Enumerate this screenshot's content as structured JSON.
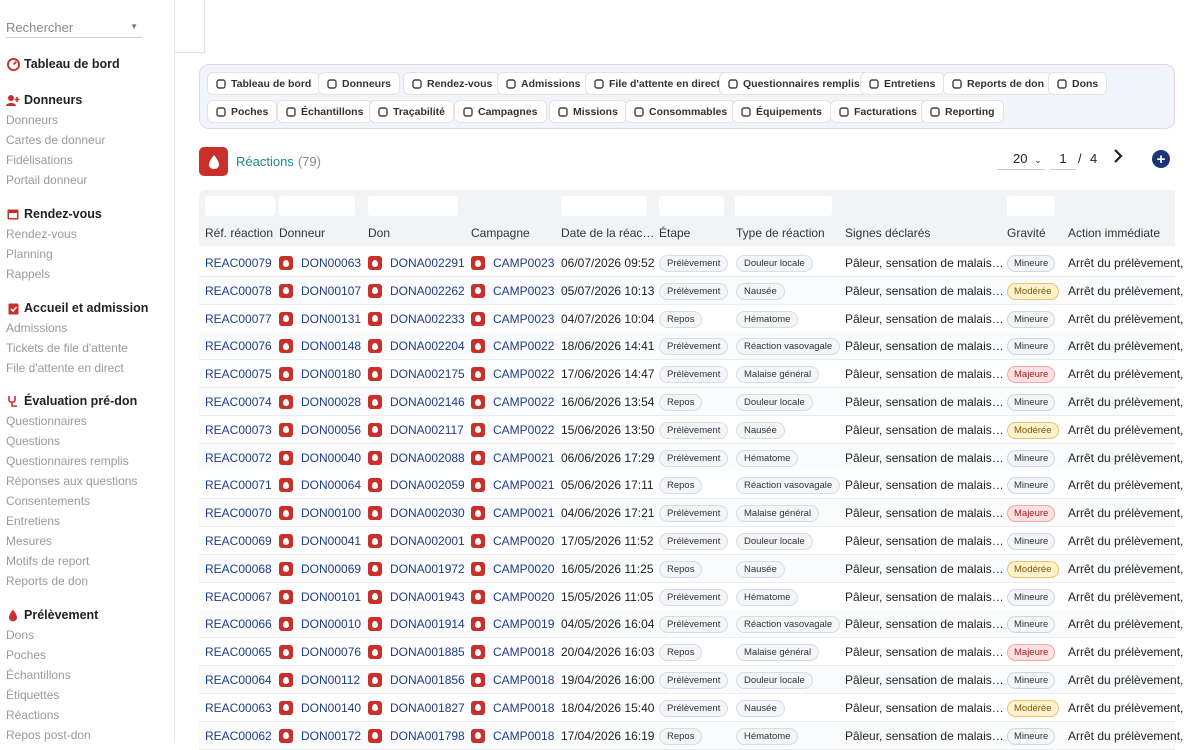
{
  "search": {
    "placeholder": "Rechercher"
  },
  "sidebar": {
    "dashboard": "Tableau de bord",
    "sections": [
      {
        "title": "Donneurs",
        "icon": "user-plus-icon",
        "items": [
          "Donneurs",
          "Cartes de donneur",
          "Fidélisations",
          "Portail donneur"
        ]
      },
      {
        "title": "Rendez-vous",
        "icon": "calendar-icon",
        "items": [
          "Rendez-vous",
          "Planning",
          "Rappels"
        ]
      },
      {
        "title": "Accueil et admission",
        "icon": "clipboard-icon",
        "items": [
          "Admissions",
          "Tickets de file d'attente",
          "File d'attente en direct"
        ]
      },
      {
        "title": "Évaluation pré-don",
        "icon": "stethoscope-icon",
        "items": [
          "Questionnaires",
          "Questions",
          "Questionnaires remplis",
          "Réponses aux questions",
          "Consentements",
          "Entretiens",
          "Mesures",
          "Motifs de report",
          "Reports de don"
        ]
      },
      {
        "title": "Prélèvement",
        "icon": "blood-drop-icon",
        "items": [
          "Dons",
          "Poches",
          "Échantillons",
          "Étiquettes",
          "Réactions",
          "Repos post-don"
        ]
      }
    ]
  },
  "modules": [
    "Tableau de bord",
    "Donneurs",
    "Rendez-vous",
    "Admissions",
    "File d'attente en direct",
    "Questionnaires remplis",
    "Entretiens",
    "Reports de don",
    "Dons",
    "Poches",
    "Échantillons",
    "Traçabilité",
    "Campagnes",
    "Missions",
    "Consommables",
    "Équipements",
    "Facturations",
    "Reporting"
  ],
  "page": {
    "title": "Réactions",
    "count": "(79)"
  },
  "pager": {
    "page_size": "20",
    "page": "1",
    "separator": "/",
    "total_pages": "4"
  },
  "colors": {
    "accent": "#c9302c",
    "link": "#1f3c88",
    "title": "#1a8a8a",
    "add_button": "#1a3578"
  },
  "table": {
    "headers": [
      "Réf. réaction",
      "Donneur",
      "Don",
      "Campagne",
      "Date de la réac…",
      "Étape",
      "Type de réaction",
      "Signes déclarés",
      "Gravité",
      "Action immédiate"
    ],
    "rows": [
      [
        "REAC00079",
        "DON00063",
        "DONA002291",
        "CAMP0023",
        "06/07/2026 09:52",
        "Prélèvement",
        "Douleur locale",
        "Pâleur, sensation de malais…",
        "Mineure",
        "Arrêt du prélèvement,"
      ],
      [
        "REAC00078",
        "DON00107",
        "DONA002262",
        "CAMP0023",
        "05/07/2026 10:13",
        "Prélèvement",
        "Nausée",
        "Pâleur, sensation de malais…",
        "Modérée",
        "Arrêt du prélèvement,"
      ],
      [
        "REAC00077",
        "DON00131",
        "DONA002233",
        "CAMP0023",
        "04/07/2026 10:04",
        "Repos",
        "Hématome",
        "Pâleur, sensation de malais…",
        "Mineure",
        "Arrêt du prélèvement,"
      ],
      [
        "REAC00076",
        "DON00148",
        "DONA002204",
        "CAMP0022",
        "18/06/2026 14:41",
        "Prélèvement",
        "Réaction vasovagale",
        "Pâleur, sensation de malais…",
        "Mineure",
        "Arrêt du prélèvement,"
      ],
      [
        "REAC00075",
        "DON00180",
        "DONA002175",
        "CAMP0022",
        "17/06/2026 14:47",
        "Prélèvement",
        "Malaise général",
        "Pâleur, sensation de malais…",
        "Majeure",
        "Arrêt du prélèvement,"
      ],
      [
        "REAC00074",
        "DON00028",
        "DONA002146",
        "CAMP0022",
        "16/06/2026 13:54",
        "Repos",
        "Douleur locale",
        "Pâleur, sensation de malais…",
        "Mineure",
        "Arrêt du prélèvement,"
      ],
      [
        "REAC00073",
        "DON00056",
        "DONA002117",
        "CAMP0022",
        "15/06/2026 13:50",
        "Prélèvement",
        "Nausée",
        "Pâleur, sensation de malais…",
        "Modérée",
        "Arrêt du prélèvement,"
      ],
      [
        "REAC00072",
        "DON00040",
        "DONA002088",
        "CAMP0021",
        "06/06/2026 17:29",
        "Prélèvement",
        "Hématome",
        "Pâleur, sensation de malais…",
        "Mineure",
        "Arrêt du prélèvement,"
      ],
      [
        "REAC00071",
        "DON00064",
        "DONA002059",
        "CAMP0021",
        "05/06/2026 17:11",
        "Repos",
        "Réaction vasovagale",
        "Pâleur, sensation de malais…",
        "Mineure",
        "Arrêt du prélèvement,"
      ],
      [
        "REAC00070",
        "DON00100",
        "DONA002030",
        "CAMP0021",
        "04/06/2026 17:21",
        "Prélèvement",
        "Malaise général",
        "Pâleur, sensation de malais…",
        "Majeure",
        "Arrêt du prélèvement,"
      ],
      [
        "REAC00069",
        "DON00041",
        "DONA002001",
        "CAMP0020",
        "17/05/2026 11:52",
        "Prélèvement",
        "Douleur locale",
        "Pâleur, sensation de malais…",
        "Mineure",
        "Arrêt du prélèvement,"
      ],
      [
        "REAC00068",
        "DON00069",
        "DONA001972",
        "CAMP0020",
        "16/05/2026 11:25",
        "Repos",
        "Nausée",
        "Pâleur, sensation de malais…",
        "Modérée",
        "Arrêt du prélèvement,"
      ],
      [
        "REAC00067",
        "DON00101",
        "DONA001943",
        "CAMP0020",
        "15/05/2026 11:05",
        "Prélèvement",
        "Hématome",
        "Pâleur, sensation de malais…",
        "Mineure",
        "Arrêt du prélèvement,"
      ],
      [
        "REAC00066",
        "DON00010",
        "DONA001914",
        "CAMP0019",
        "04/05/2026 16:04",
        "Prélèvement",
        "Réaction vasovagale",
        "Pâleur, sensation de malais…",
        "Mineure",
        "Arrêt du prélèvement,"
      ],
      [
        "REAC00065",
        "DON00076",
        "DONA001885",
        "CAMP0018",
        "20/04/2026 16:03",
        "Repos",
        "Malaise général",
        "Pâleur, sensation de malais…",
        "Majeure",
        "Arrêt du prélèvement,"
      ],
      [
        "REAC00064",
        "DON00112",
        "DONA001856",
        "CAMP0018",
        "19/04/2026 16:00",
        "Prélèvement",
        "Douleur locale",
        "Pâleur, sensation de malais…",
        "Mineure",
        "Arrêt du prélèvement,"
      ],
      [
        "REAC00063",
        "DON00140",
        "DONA001827",
        "CAMP0018",
        "18/04/2026 15:40",
        "Prélèvement",
        "Nausée",
        "Pâleur, sensation de malais…",
        "Modérée",
        "Arrêt du prélèvement,"
      ],
      [
        "REAC00062",
        "DON00172",
        "DONA001798",
        "CAMP0018",
        "17/04/2026 16:19",
        "Repos",
        "Hématome",
        "Pâleur, sensation de malais…",
        "Mineure",
        "Arrêt du prélèvement,"
      ]
    ]
  }
}
